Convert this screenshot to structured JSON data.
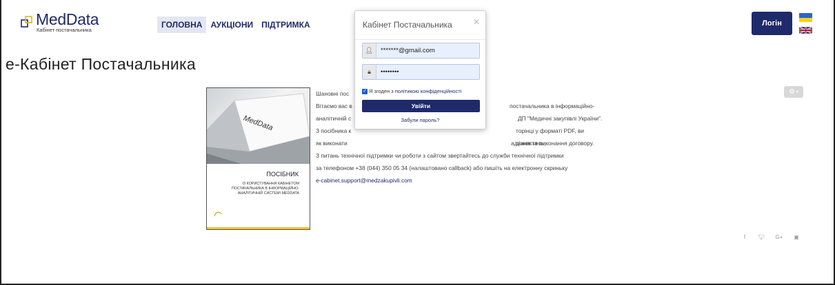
{
  "header": {
    "logo_title": "MedData",
    "logo_subtitle": "Кабінет постачальника",
    "nav": [
      {
        "label": "ГОЛОВНА",
        "active": true
      },
      {
        "label": "АУКЦІОНИ",
        "active": false
      },
      {
        "label": "ПІДТРИМКА",
        "active": false
      }
    ],
    "login_label": "Логін",
    "languages": [
      "ua-flag-icon",
      "uk-flag-icon"
    ]
  },
  "page": {
    "title": "е-Кабінет Постачальника"
  },
  "book": {
    "brand": "MedData",
    "title": "ПОСІБНИК",
    "subtitle_lines": [
      "ІЗ КОРИСТУВАННЯ КАБІНЕТОМ",
      "ПОСТАЧАЛЬНИКА В ІНФОРМАЦІЙНО-",
      "АНАЛІТИЧНІЙ СИСТЕМІ MEDDATA"
    ]
  },
  "content": {
    "lines": [
      "Шановні пос",
      "Вітаємо вас в",
      "аналітичній с",
      "З посібника к",
      "як виконати",
      "З питань технічної підтримки чи роботи з сайтом звертайтесь до служби технічної підтримки",
      "за телефоном +38 (044) 350 05 34 (налаштовано callback) або пишіть на електронну скриньку"
    ],
    "right_fragments": [
      "постачальника в інформаційно-",
      "ДП \"Медичні закупівлі України\".",
      "торінці у форматі PDF, ви дізнаєтесь,",
      "адання та виконання договору."
    ],
    "email": "e-cabinet.support@medzakupivli.com"
  },
  "modal": {
    "title": "Кабінет Постачальника",
    "email_value": "*******@gmail.com",
    "password_value": "••••••••",
    "agree_prefix": "Я згоден з ",
    "agree_link": "політикою конфіденційності",
    "submit_label": "Увійти",
    "forgot_label": "Забули пароль?"
  },
  "colors": {
    "brand": "#1f2a6b",
    "accent_yellow": "#f1c232"
  },
  "social": [
    "facebook-icon",
    "twitter-icon",
    "google-plus-icon",
    "linkedin-icon"
  ]
}
